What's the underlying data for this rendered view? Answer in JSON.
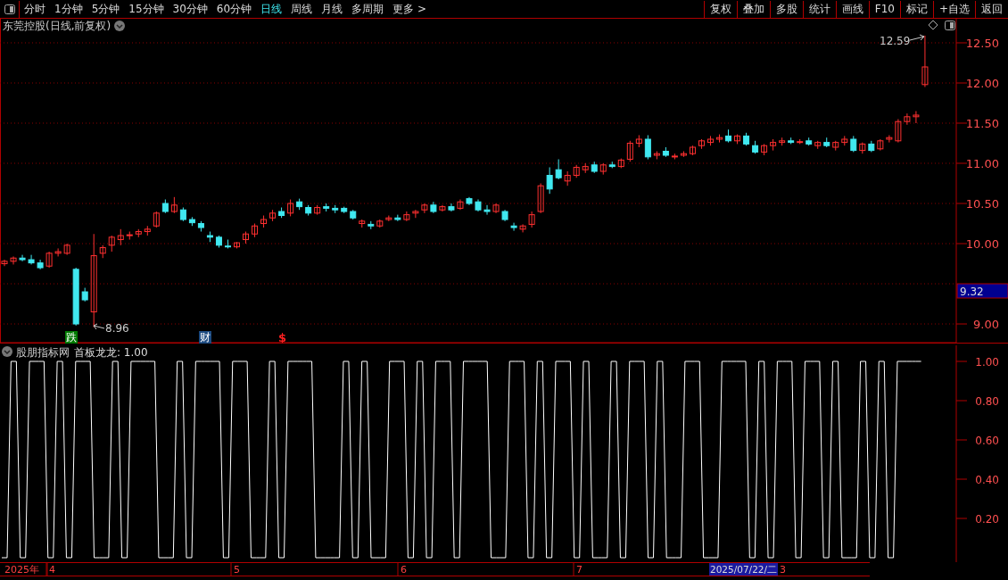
{
  "toolbar": {
    "periods": [
      {
        "label": "分时",
        "selected": false
      },
      {
        "label": "1分钟",
        "selected": false
      },
      {
        "label": "5分钟",
        "selected": false
      },
      {
        "label": "15分钟",
        "selected": false
      },
      {
        "label": "30分钟",
        "selected": false
      },
      {
        "label": "60分钟",
        "selected": false
      },
      {
        "label": "日线",
        "selected": true
      },
      {
        "label": "周线",
        "selected": false
      },
      {
        "label": "月线",
        "selected": false
      },
      {
        "label": "多周期",
        "selected": false
      },
      {
        "label": "更多 >",
        "selected": false
      }
    ],
    "buttons": [
      "复权",
      "叠加",
      "多股",
      "统计",
      "画线",
      "F10",
      "标记",
      "+自选",
      "返回"
    ]
  },
  "main_chart": {
    "title": "东莞控股(日线,前复权)",
    "current_price": "9.32",
    "high_label": "12.59",
    "low_label": "8.96",
    "chart_data": {
      "type": "candlestick",
      "grid": true,
      "ylim": [
        8.756,
        12.811
      ],
      "categories": [
        null,
        null,
        null,
        null,
        null,
        null,
        null,
        null,
        null,
        null,
        null,
        null,
        null,
        null,
        null,
        null,
        null,
        null,
        null,
        null,
        null,
        null,
        null,
        null,
        null,
        null,
        null,
        null,
        null,
        null,
        null,
        null,
        null,
        null,
        null,
        null,
        null,
        null,
        null,
        null,
        null,
        null,
        null,
        null,
        null,
        null,
        null,
        null,
        null,
        null,
        null,
        null,
        null,
        null,
        null,
        null,
        null,
        null,
        null,
        null,
        null,
        null,
        null,
        null,
        null,
        null,
        null,
        null,
        null,
        null,
        null,
        null,
        null,
        null,
        null,
        null,
        null,
        null,
        null,
        null,
        null,
        null,
        null,
        null,
        null,
        null,
        null,
        null,
        null,
        null,
        null,
        null,
        null,
        null,
        null,
        null,
        null,
        null,
        null,
        null,
        null,
        null,
        null,
        null,
        null,
        null,
        null
      ],
      "yticks": [
        {
          "value": 12.5,
          "label": "12.50"
        },
        {
          "value": 12,
          "label": "12.00"
        },
        {
          "value": 11.5,
          "label": "11.50"
        },
        {
          "value": 11,
          "label": "11.00"
        },
        {
          "value": 10.5,
          "label": "10.50"
        },
        {
          "value": 10,
          "label": "10.00"
        },
        {
          "value": 9,
          "label": "9.00"
        }
      ],
      "ohlc": [
        [
          9.75,
          9.8,
          9.72,
          9.78
        ],
        [
          9.78,
          9.84,
          9.74,
          9.82
        ],
        [
          9.82,
          9.86,
          9.78,
          9.8
        ],
        [
          9.8,
          9.86,
          9.74,
          9.76
        ],
        [
          9.76,
          9.8,
          9.68,
          9.7
        ],
        [
          9.72,
          9.9,
          9.7,
          9.88
        ],
        [
          9.88,
          9.94,
          9.84,
          9.9
        ],
        [
          9.88,
          10.0,
          9.86,
          9.98
        ],
        [
          9.68,
          9.7,
          8.98,
          9.0
        ],
        [
          9.4,
          9.45,
          9.28,
          9.3
        ],
        [
          9.15,
          10.12,
          8.96,
          9.85
        ],
        [
          9.88,
          9.98,
          9.82,
          9.95
        ],
        [
          9.98,
          10.1,
          9.9,
          10.08
        ],
        [
          10.05,
          10.18,
          9.98,
          10.1
        ],
        [
          10.1,
          10.15,
          10.05,
          10.11
        ],
        [
          10.12,
          10.18,
          10.08,
          10.15
        ],
        [
          10.15,
          10.22,
          10.1,
          10.18
        ],
        [
          10.22,
          10.4,
          10.2,
          10.38
        ],
        [
          10.5,
          10.55,
          10.38,
          10.4
        ],
        [
          10.4,
          10.58,
          10.38,
          10.48
        ],
        [
          10.42,
          10.45,
          10.28,
          10.3
        ],
        [
          10.3,
          10.33,
          10.22,
          10.26
        ],
        [
          10.25,
          10.28,
          10.15,
          10.2
        ],
        [
          10.1,
          10.15,
          10.02,
          10.08
        ],
        [
          10.08,
          10.1,
          9.95,
          9.98
        ],
        [
          9.97,
          10.05,
          9.94,
          9.96
        ],
        [
          9.96,
          10.02,
          9.94,
          10.01
        ],
        [
          10.05,
          10.15,
          10.0,
          10.12
        ],
        [
          10.12,
          10.25,
          10.08,
          10.22
        ],
        [
          10.25,
          10.35,
          10.2,
          10.3
        ],
        [
          10.32,
          10.42,
          10.28,
          10.38
        ],
        [
          10.4,
          10.45,
          10.32,
          10.35
        ],
        [
          10.38,
          10.55,
          10.34,
          10.5
        ],
        [
          10.52,
          10.56,
          10.42,
          10.46
        ],
        [
          10.45,
          10.48,
          10.35,
          10.38
        ],
        [
          10.38,
          10.48,
          10.36,
          10.45
        ],
        [
          10.46,
          10.5,
          10.4,
          10.44
        ],
        [
          10.44,
          10.48,
          10.38,
          10.42
        ],
        [
          10.44,
          10.46,
          10.38,
          10.4
        ],
        [
          10.4,
          10.42,
          10.3,
          10.32
        ],
        [
          10.25,
          10.3,
          10.2,
          10.28
        ],
        [
          10.24,
          10.28,
          10.18,
          10.22
        ],
        [
          10.22,
          10.3,
          10.2,
          10.28
        ],
        [
          10.3,
          10.35,
          10.28,
          10.32
        ],
        [
          10.32,
          10.36,
          10.28,
          10.3
        ],
        [
          10.3,
          10.4,
          10.28,
          10.36
        ],
        [
          10.38,
          10.42,
          10.32,
          10.4
        ],
        [
          10.42,
          10.5,
          10.38,
          10.48
        ],
        [
          10.48,
          10.52,
          10.38,
          10.4
        ],
        [
          10.42,
          10.48,
          10.4,
          10.46
        ],
        [
          10.46,
          10.5,
          10.4,
          10.42
        ],
        [
          10.44,
          10.55,
          10.42,
          10.52
        ],
        [
          10.56,
          10.58,
          10.48,
          10.5
        ],
        [
          10.52,
          10.55,
          10.4,
          10.42
        ],
        [
          10.42,
          10.48,
          10.36,
          10.4
        ],
        [
          10.4,
          10.5,
          10.38,
          10.48
        ],
        [
          10.4,
          10.42,
          10.28,
          10.3
        ],
        [
          10.22,
          10.26,
          10.16,
          10.2
        ],
        [
          10.18,
          10.24,
          10.14,
          10.22
        ],
        [
          10.24,
          10.4,
          10.2,
          10.36
        ],
        [
          10.4,
          10.75,
          10.38,
          10.72
        ],
        [
          10.85,
          10.95,
          10.62,
          10.68
        ],
        [
          10.92,
          11.05,
          10.8,
          10.82
        ],
        [
          10.78,
          10.9,
          10.72,
          10.85
        ],
        [
          10.85,
          10.98,
          10.82,
          10.95
        ],
        [
          10.92,
          11.0,
          10.88,
          10.96
        ],
        [
          10.98,
          11.02,
          10.88,
          10.9
        ],
        [
          10.9,
          11.0,
          10.86,
          10.98
        ],
        [
          10.98,
          11.02,
          10.94,
          10.96
        ],
        [
          10.96,
          11.06,
          10.94,
          11.04
        ],
        [
          11.05,
          11.28,
          11.02,
          11.25
        ],
        [
          11.25,
          11.35,
          11.2,
          11.3
        ],
        [
          11.3,
          11.35,
          11.05,
          11.08
        ],
        [
          11.1,
          11.15,
          11.05,
          11.12
        ],
        [
          11.15,
          11.2,
          11.08,
          11.1
        ],
        [
          11.08,
          11.12,
          11.05,
          11.09
        ],
        [
          11.1,
          11.15,
          11.08,
          11.12
        ],
        [
          11.12,
          11.22,
          11.1,
          11.2
        ],
        [
          11.22,
          11.3,
          11.18,
          11.28
        ],
        [
          11.26,
          11.34,
          11.22,
          11.3
        ],
        [
          11.3,
          11.36,
          11.26,
          11.32
        ],
        [
          11.34,
          11.42,
          11.26,
          11.28
        ],
        [
          11.28,
          11.36,
          11.24,
          11.34
        ],
        [
          11.34,
          11.38,
          11.22,
          11.24
        ],
        [
          11.22,
          11.28,
          11.12,
          11.14
        ],
        [
          11.14,
          11.24,
          11.1,
          11.22
        ],
        [
          11.22,
          11.3,
          11.16,
          11.26
        ],
        [
          11.26,
          11.32,
          11.22,
          11.28
        ],
        [
          11.28,
          11.32,
          11.24,
          11.26
        ],
        [
          11.26,
          11.3,
          11.24,
          11.27
        ],
        [
          11.28,
          11.32,
          11.22,
          11.24
        ],
        [
          11.22,
          11.28,
          11.18,
          11.26
        ],
        [
          11.26,
          11.32,
          11.2,
          11.22
        ],
        [
          11.2,
          11.28,
          11.16,
          11.26
        ],
        [
          11.26,
          11.34,
          11.22,
          11.3
        ],
        [
          11.3,
          11.34,
          11.14,
          11.16
        ],
        [
          11.16,
          11.26,
          11.12,
          11.24
        ],
        [
          11.24,
          11.28,
          11.14,
          11.16
        ],
        [
          11.18,
          11.3,
          11.16,
          11.28
        ],
        [
          11.3,
          11.35,
          11.26,
          11.32
        ],
        [
          11.28,
          11.55,
          11.26,
          11.52
        ],
        [
          11.52,
          11.62,
          11.48,
          11.58
        ],
        [
          11.58,
          11.65,
          11.5,
          11.6
        ],
        [
          11.98,
          12.59,
          11.95,
          12.2
        ],
        null,
        null,
        null
      ]
    },
    "event_markers": [
      {
        "label": "跌",
        "color": "#007a00"
      },
      {
        "label": "财",
        "color": "#1c4a80"
      },
      {
        "label": "$",
        "color": "#ff2020"
      }
    ]
  },
  "indicator": {
    "source": "股朋指标网",
    "name": "首板龙龙:",
    "value": "1.00",
    "axis": [
      "1.00",
      "0.80",
      "0.60",
      "0.40",
      "0.20"
    ]
  },
  "date_axis": {
    "labels": [
      "2025年",
      "4",
      "5",
      "6",
      "7"
    ],
    "cursor_date": "2025/07/22/二",
    "after_cursor": "3"
  }
}
